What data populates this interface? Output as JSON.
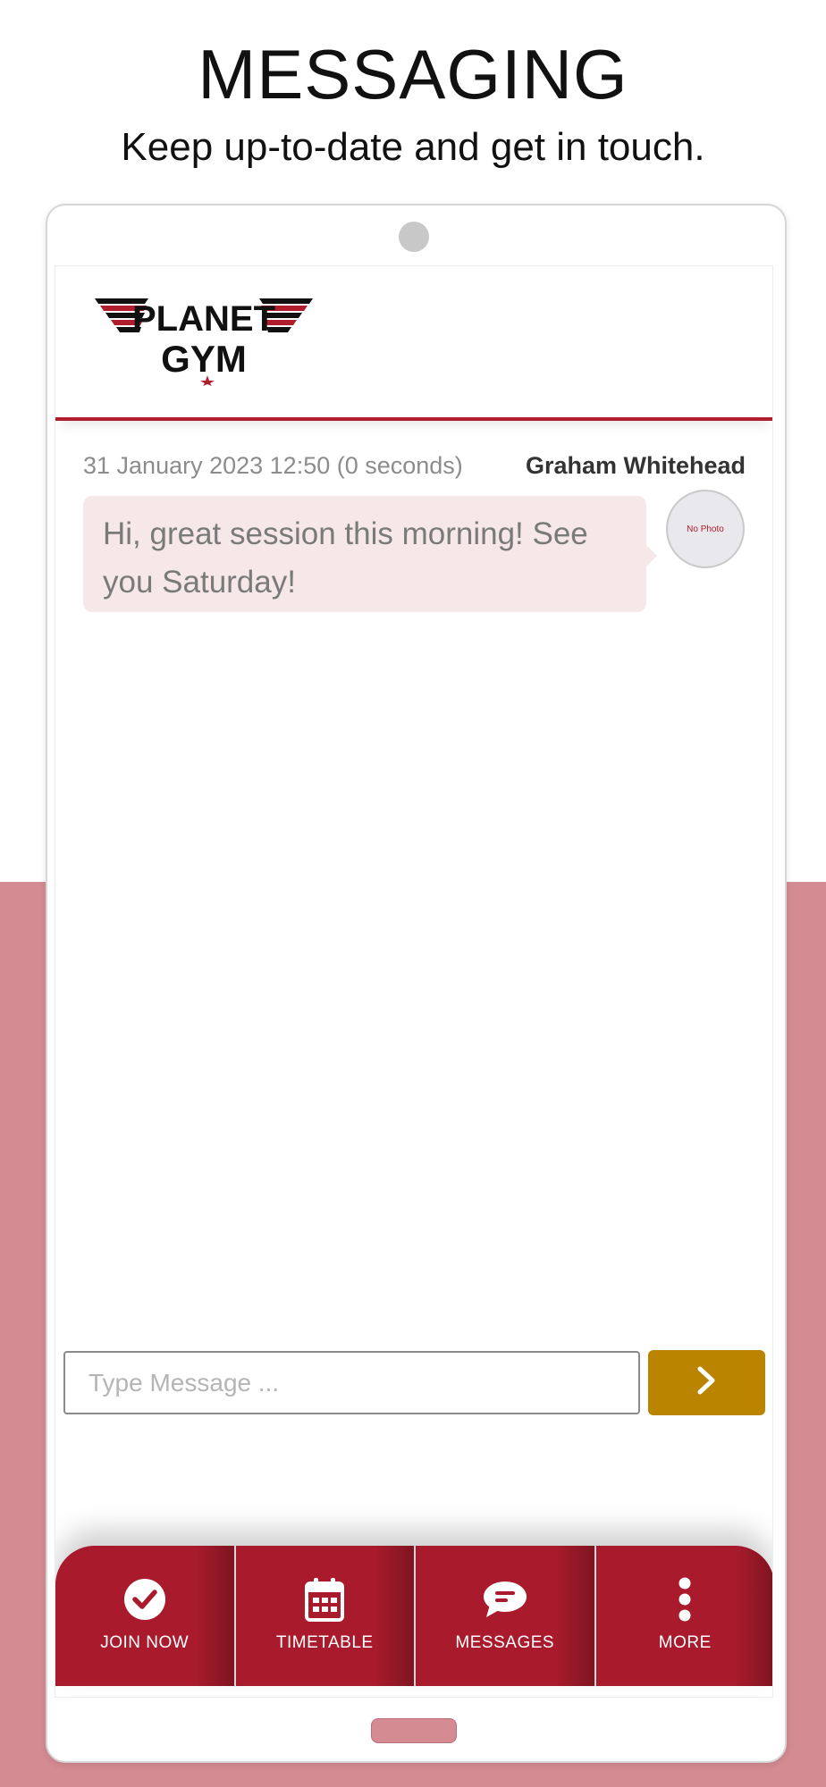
{
  "page": {
    "headline": "MESSAGING",
    "subheadline": "Keep up-to-date and get in touch."
  },
  "brand": {
    "logo_line1": "PLANET",
    "logo_line2": "GYM",
    "accent_color": "#a91b2c",
    "send_color": "#bb8400",
    "background_band_color": "#d48b92"
  },
  "message": {
    "timestamp": "31 January 2023 12:50 (0 seconds)",
    "sender": "Graham Whitehead",
    "text": "Hi, great session this morning! See you Saturday!",
    "avatar_text": "No Photo"
  },
  "composer": {
    "placeholder": "Type Message ...",
    "send_icon": "chevron-right-icon"
  },
  "tabs": [
    {
      "label": "JOIN NOW",
      "icon": "check-circle-icon"
    },
    {
      "label": "TIMETABLE",
      "icon": "calendar-icon"
    },
    {
      "label": "MESSAGES",
      "icon": "chat-bubble-icon"
    },
    {
      "label": "MORE",
      "icon": "more-vertical-icon"
    }
  ]
}
